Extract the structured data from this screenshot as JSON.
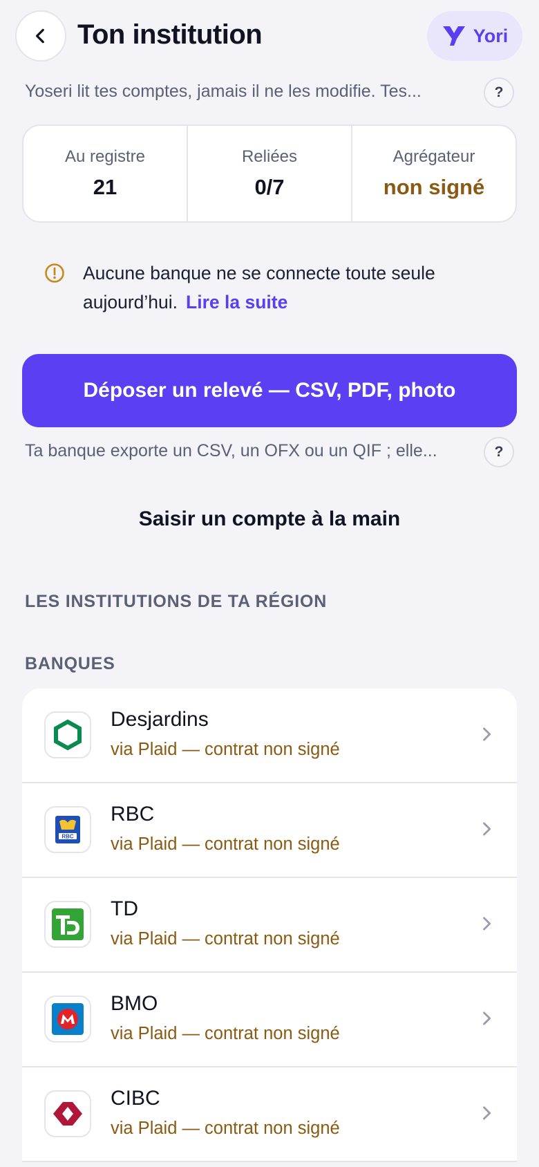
{
  "header": {
    "title": "Ton institution",
    "assistant_name": "Yori"
  },
  "intro": {
    "text": "Yoseri lit tes comptes, jamais il ne les modifie. Tes...",
    "help": "?"
  },
  "stats": [
    {
      "label": "Au registre",
      "value": "21"
    },
    {
      "label": "Reliées",
      "value": "0/7"
    },
    {
      "label": "Agrégateur",
      "value": "non signé"
    }
  ],
  "notice": {
    "text": "Aucune banque ne se connecte toute seule aujourd’hui.",
    "link": "Lire la suite"
  },
  "upload": {
    "button_label": "Déposer un relevé — CSV, PDF, photo",
    "hint": "Ta banque exporte un CSV, un OFX ou un QIF ; elle...",
    "help": "?"
  },
  "manual_entry_label": "Saisir un compte à la main",
  "region_title": "LES INSTITUTIONS DE TA RÉGION",
  "banks_title": "BANQUES",
  "banks": [
    {
      "name": "Desjardins",
      "status": "via Plaid — contrat non signé"
    },
    {
      "name": "RBC",
      "status": "via Plaid — contrat non signé"
    },
    {
      "name": "TD",
      "status": "via Plaid — contrat non signé"
    },
    {
      "name": "BMO",
      "status": "via Plaid — contrat non signé"
    },
    {
      "name": "CIBC",
      "status": "via Plaid — contrat non signé"
    }
  ],
  "colors": {
    "accent": "#5b3ff3",
    "warning": "#8a5a12",
    "background": "#f3f3f8"
  }
}
